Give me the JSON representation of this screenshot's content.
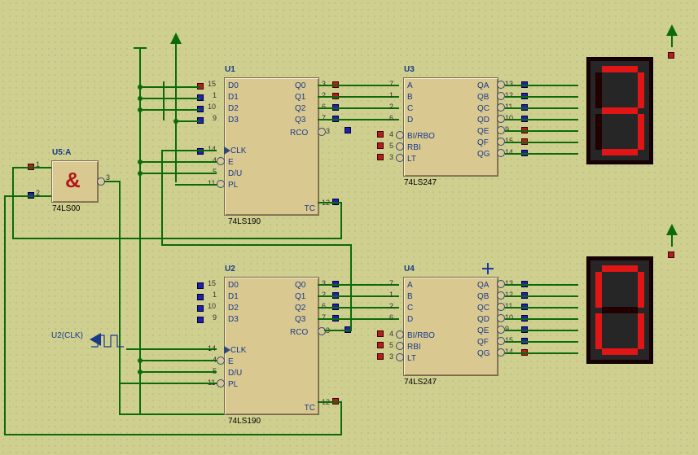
{
  "components": {
    "U1": {
      "ref": "U1",
      "part": "74LS190",
      "pins_left": [
        "D0",
        "D1",
        "D2",
        "D3",
        "",
        "CLK",
        "E",
        "D/U",
        "PL"
      ],
      "nums_left": [
        "15",
        "1",
        "10",
        "9",
        "",
        "14",
        "4",
        "5",
        "11"
      ],
      "pins_right": [
        "Q0",
        "Q1",
        "Q2",
        "Q3",
        "RCO",
        "",
        "",
        "",
        "TC"
      ],
      "nums_right": [
        "3",
        "2",
        "6",
        "7",
        "13",
        "",
        "",
        "",
        "12"
      ]
    },
    "U2": {
      "ref": "U2",
      "part": "74LS190",
      "pins_left": [
        "D0",
        "D1",
        "D2",
        "D3",
        "",
        "CLK",
        "E",
        "D/U",
        "PL"
      ],
      "nums_left": [
        "15",
        "1",
        "10",
        "9",
        "",
        "14",
        "4",
        "5",
        "11"
      ],
      "pins_right": [
        "Q0",
        "Q1",
        "Q2",
        "Q3",
        "RCO",
        "",
        "",
        "",
        "TC"
      ],
      "nums_right": [
        "3",
        "2",
        "6",
        "7",
        "13",
        "",
        "",
        "",
        "12"
      ]
    },
    "U3": {
      "ref": "U3",
      "part": "74LS247",
      "pins_left": [
        "A",
        "B",
        "C",
        "D",
        "BI/RBO",
        "RBI",
        "LT"
      ],
      "nums_left": [
        "7",
        "1",
        "2",
        "6",
        "4",
        "5",
        "3"
      ],
      "pins_right": [
        "QA",
        "QB",
        "QC",
        "QD",
        "QE",
        "QF",
        "QG"
      ],
      "nums_right": [
        "13",
        "12",
        "11",
        "10",
        "9",
        "15",
        "14"
      ]
    },
    "U4": {
      "ref": "U4",
      "part": "74LS247",
      "pins_left": [
        "A",
        "B",
        "C",
        "D",
        "BI/RBO",
        "RBI",
        "LT"
      ],
      "nums_left": [
        "7",
        "1",
        "2",
        "6",
        "4",
        "5",
        "3"
      ],
      "pins_right": [
        "QA",
        "QB",
        "QC",
        "QD",
        "QE",
        "QF",
        "QG"
      ],
      "nums_right": [
        "13",
        "12",
        "11",
        "10",
        "9",
        "15",
        "14"
      ]
    },
    "U5A": {
      "ref": "U5:A",
      "part": "74LS00",
      "nums": [
        "1",
        "2",
        "3"
      ],
      "sym": "&"
    }
  },
  "probe": {
    "label": "U2(CLK)"
  },
  "displays": {
    "top": {
      "value": "3",
      "a": true,
      "b": true,
      "c": true,
      "d": true,
      "e": false,
      "f": false,
      "g": true
    },
    "bot": {
      "value": "0",
      "a": true,
      "b": true,
      "c": true,
      "d": true,
      "e": true,
      "f": true,
      "g": false
    }
  }
}
